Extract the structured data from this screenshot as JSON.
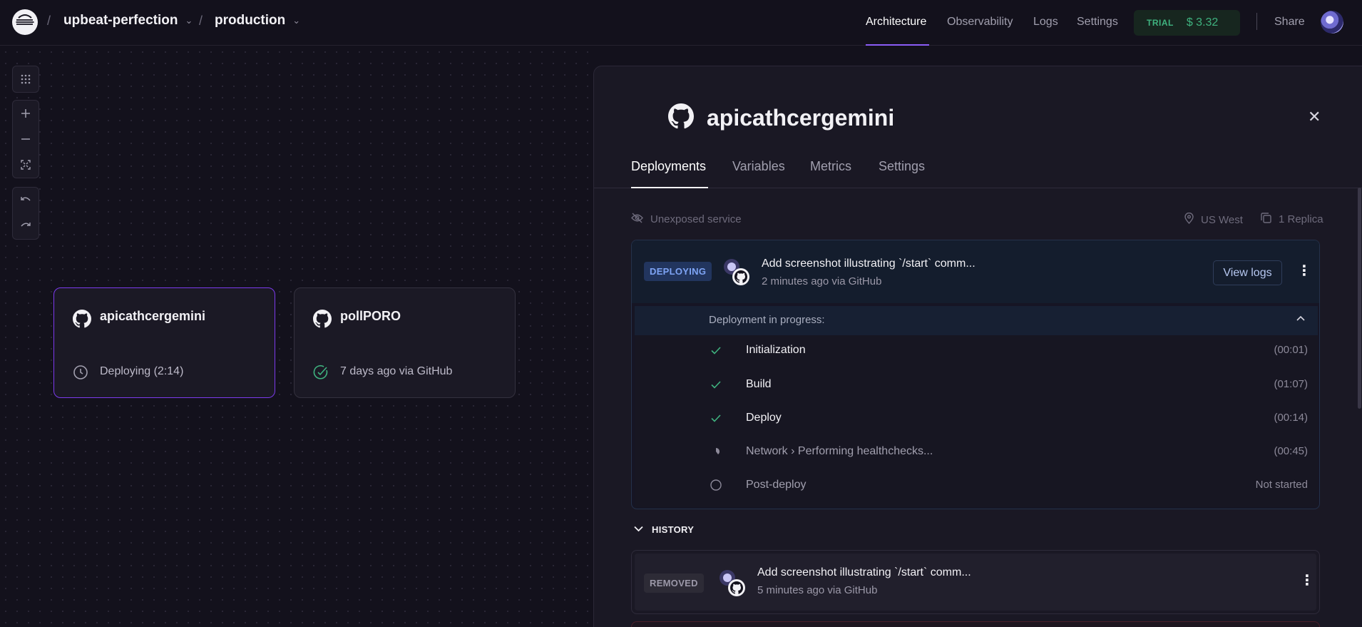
{
  "header": {
    "project_name": "upbeat-perfection",
    "environment": "production",
    "nav": {
      "architecture": "Architecture",
      "observability": "Observability",
      "logs": "Logs",
      "settings": "Settings"
    },
    "trial_label": "TRIAL",
    "trial_balance": "$ 3.32",
    "share": "Share"
  },
  "canvas": {
    "controls": [
      "grid-icon",
      "zoom-in-icon",
      "zoom-out-icon",
      "fit-view-icon",
      "undo-icon",
      "redo-icon"
    ],
    "services": [
      {
        "name": "apicathcergemini",
        "status": "Deploying (2:14)",
        "status_icon": "clock-icon",
        "selected": true
      },
      {
        "name": "pollPORO",
        "status": "7 days ago via GitHub",
        "status_icon": "check-circle-icon",
        "selected": false
      }
    ]
  },
  "panel": {
    "service_name": "apicathcergemini",
    "tabs": [
      "Deployments",
      "Variables",
      "Metrics",
      "Settings"
    ],
    "active_tab": "Deployments",
    "exposure": "Unexposed service",
    "region": "US West",
    "replicas": "1 Replica",
    "active_deployment": {
      "badge": "DEPLOYING",
      "commit_message": "Add screenshot illustrating `/start` comm...",
      "subtitle": "2 minutes ago via GitHub",
      "view_logs": "View logs",
      "progress_label": "Deployment in progress:",
      "steps": [
        {
          "name": "Initialization",
          "time": "(00:01)",
          "state": "done"
        },
        {
          "name": "Build",
          "time": "(01:07)",
          "state": "done"
        },
        {
          "name": "Deploy",
          "time": "(00:14)",
          "state": "done"
        },
        {
          "name": "Network › Performing healthchecks...",
          "time": "(00:45)",
          "state": "running"
        },
        {
          "name": "Post-deploy",
          "time": "Not started",
          "state": "pending"
        }
      ]
    },
    "history_label": "HISTORY",
    "history": [
      {
        "badge": "REMOVED",
        "commit_message": "Add screenshot illustrating `/start` comm...",
        "subtitle": "5 minutes ago via GitHub"
      }
    ]
  },
  "colors": {
    "background": "#13111c",
    "accent": "#8b5cf6",
    "trial_green": "#3fb27f",
    "deploying_blue": "#7ea4f5"
  }
}
